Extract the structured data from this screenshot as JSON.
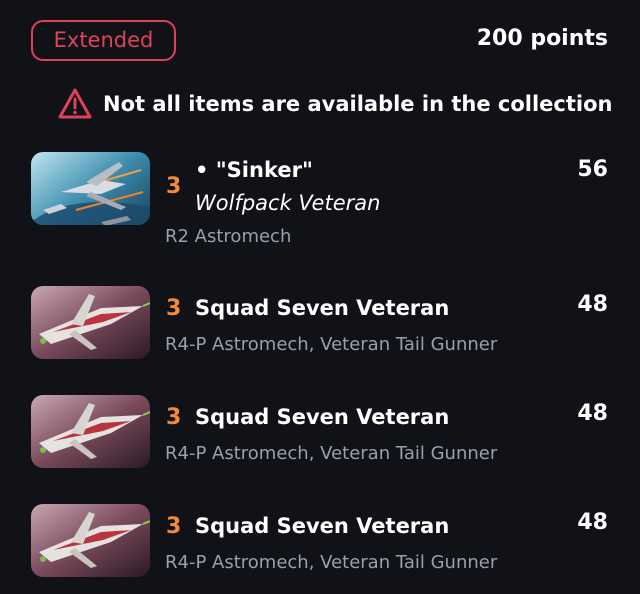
{
  "header": {
    "format_label": "Extended",
    "points_total": "200 points"
  },
  "warning": {
    "icon": "warning-triangle-icon",
    "text": "Not all items are available in the collection",
    "color": "#e0415a"
  },
  "ships": [
    {
      "initiative": "3",
      "pilot_name": "• \"Sinker\"",
      "pilot_title": "Wolfpack Veteran",
      "upgrades": "R2 Astromech",
      "points": "56",
      "image": "arc-170-starfighter-art"
    },
    {
      "initiative": "3",
      "pilot_name": "Squad Seven Veteran",
      "upgrades": "R4-P Astromech, Veteran Tail Gunner",
      "points": "48",
      "image": "arc-170-red-starfighter-art"
    },
    {
      "initiative": "3",
      "pilot_name": "Squad Seven Veteran",
      "upgrades": "R4-P Astromech, Veteran Tail Gunner",
      "points": "48",
      "image": "arc-170-red-starfighter-art"
    },
    {
      "initiative": "3",
      "pilot_name": "Squad Seven Veteran",
      "upgrades": "R4-P Astromech, Veteran Tail Gunner",
      "points": "48",
      "image": "arc-170-red-starfighter-art"
    }
  ],
  "colors": {
    "background": "#101217",
    "accent_red": "#e0415a",
    "initiative_orange": "#f28a3a",
    "secondary_text": "#9aa0ab"
  }
}
